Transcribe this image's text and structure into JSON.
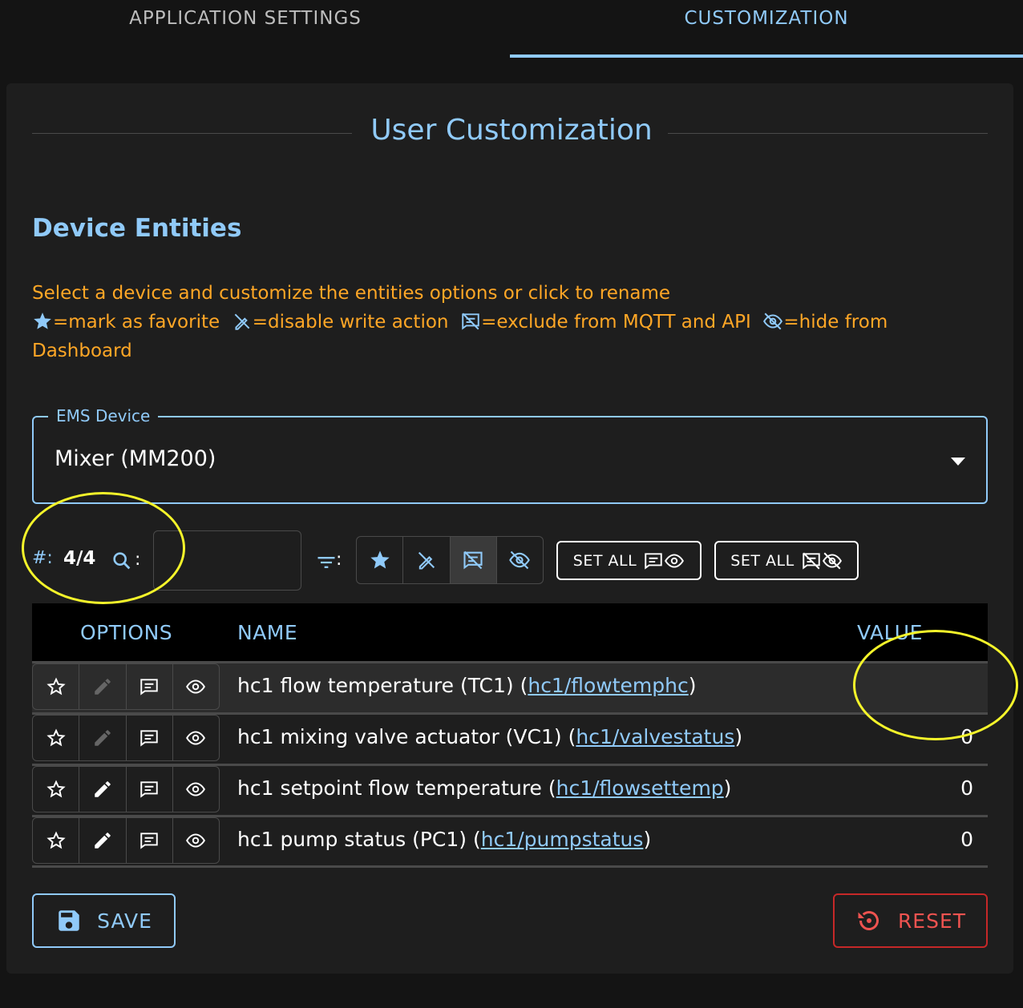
{
  "tabs": {
    "app_settings": "APPLICATION SETTINGS",
    "customization": "CUSTOMIZATION"
  },
  "panel": {
    "title": "User Customization",
    "section_title": "Device Entities",
    "help_line1": "Select a device and customize the entities options or click to rename",
    "help_fav": "=mark as favorite",
    "help_write": "=disable write action",
    "help_mqtt": "=exclude from MQTT and API",
    "help_hide": "=hide from Dashboard"
  },
  "select": {
    "label": "EMS Device",
    "value": "Mixer (MM200)"
  },
  "toolbar": {
    "hash_label": "#:",
    "count": "4/4",
    "colon": ":",
    "search_placeholder": "",
    "set_all_1": "SET ALL",
    "set_all_2": "SET ALL"
  },
  "table": {
    "columns": [
      "OPTIONS",
      "NAME",
      "VALUE"
    ],
    "rows": [
      {
        "name": "hc1 flow temperature (TC1) (",
        "link": "hc1/flowtemphc",
        "suffix": ")",
        "value": "",
        "write_disabled": true
      },
      {
        "name": "hc1 mixing valve actuator (VC1) (",
        "link": "hc1/valvestatus",
        "suffix": ")",
        "value": "0",
        "write_disabled": true
      },
      {
        "name": "hc1 setpoint flow temperature (",
        "link": "hc1/flowsettemp",
        "suffix": ")",
        "value": "0",
        "write_disabled": false
      },
      {
        "name": "hc1 pump status (PC1) (",
        "link": "hc1/pumpstatus",
        "suffix": ")",
        "value": "0",
        "write_disabled": false
      }
    ]
  },
  "buttons": {
    "save": "SAVE",
    "reset": "RESET"
  },
  "colors": {
    "accent": "#90caf9",
    "warning": "#ffa726",
    "danger": "#ef5350",
    "annotation": "#f5f52a"
  }
}
